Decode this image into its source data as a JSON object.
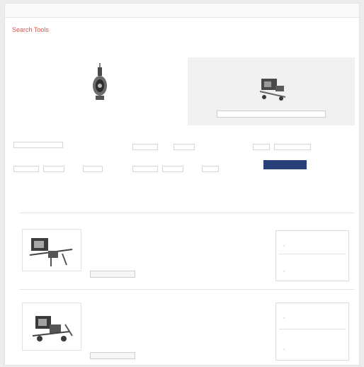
{
  "nav": {
    "items": [
      "",
      "",
      "",
      ""
    ],
    "right": ""
  },
  "page_title": "Search Tools",
  "intro": "",
  "hero": {
    "left_caption": "",
    "right_button": ""
  },
  "filters": {
    "field1_label": "",
    "field1_value": "",
    "field2_label": "",
    "field2_value": "",
    "field2_unit_a": "",
    "field2_unit_b": "",
    "field3_label": "",
    "field3_value": "",
    "field4_label": "",
    "field4_value": "",
    "field5_label": "",
    "field5_value": "",
    "more_link": ""
  },
  "actions": {
    "search_label": "",
    "reset_label": ""
  },
  "results": [
    {
      "category": "",
      "name": "",
      "availability": "",
      "description": "",
      "button": "",
      "side_title_1": "",
      "side_value_1": "",
      "side_title_2": "",
      "side_value_2": ""
    },
    {
      "category": "",
      "name": "",
      "availability": "",
      "description": "",
      "button": "",
      "side_title_1": "",
      "side_value_1": "",
      "side_title_2": "",
      "side_value_2": ""
    }
  ],
  "colors": {
    "title": "#d9534f",
    "primary_button": "#27407a",
    "hero_panel": "#f1f1f1"
  }
}
